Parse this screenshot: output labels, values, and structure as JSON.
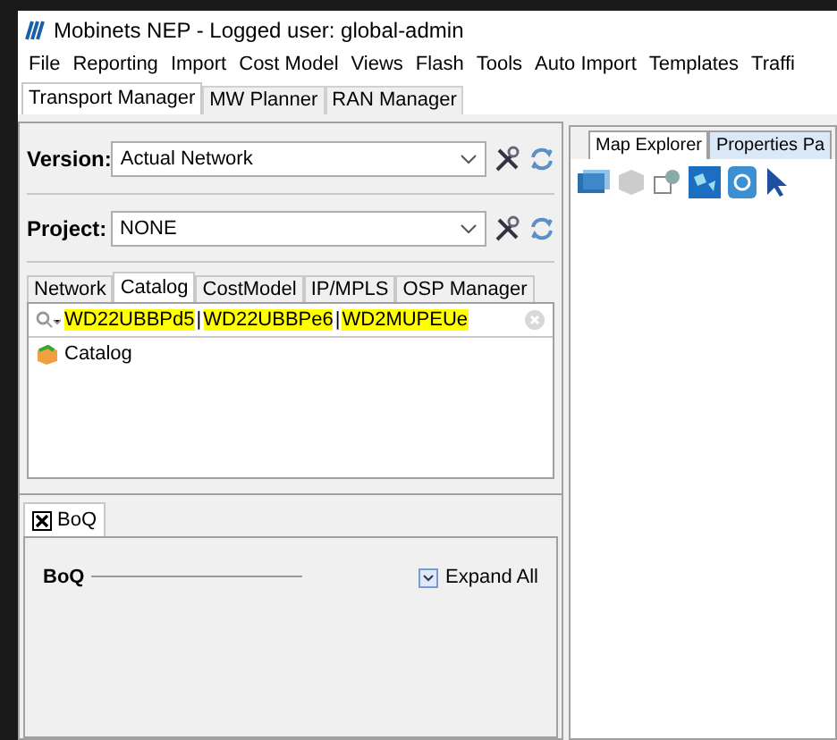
{
  "window": {
    "title": "Mobinets NEP - Logged user: global-admin"
  },
  "menu": [
    "File",
    "Reporting",
    "Import",
    "Cost Model",
    "Views",
    "Flash",
    "Tools",
    "Auto Import",
    "Templates",
    "Traffi"
  ],
  "main_tabs": [
    {
      "label": "Transport Manager",
      "selected": true
    },
    {
      "label": "MW Planner",
      "selected": false
    },
    {
      "label": "RAN Manager",
      "selected": false
    }
  ],
  "version": {
    "label": "Version:",
    "value": "Actual Network"
  },
  "project": {
    "label": "Project:",
    "value": "NONE"
  },
  "sub_tabs": [
    {
      "label": "Network",
      "selected": false
    },
    {
      "label": "Catalog",
      "selected": true
    },
    {
      "label": "CostModel",
      "selected": false
    },
    {
      "label": "IP/MPLS",
      "selected": false
    },
    {
      "label": "OSP Manager",
      "selected": false
    }
  ],
  "search": {
    "segments": [
      {
        "text": "WD22UBBPd5",
        "highlighted": true
      },
      {
        "text": "|",
        "highlighted": false
      },
      {
        "text": "WD22UBBPe6",
        "highlighted": true
      },
      {
        "text": "|",
        "highlighted": false
      },
      {
        "text": "WD2MUPEUe",
        "highlighted": true
      }
    ]
  },
  "tree": [
    {
      "label": "Catalog"
    }
  ],
  "bottom_tab": {
    "label": "BoQ"
  },
  "boq": {
    "title": "BoQ",
    "expand_all": "Expand All",
    "checked": true
  },
  "right_tabs": [
    {
      "label": "Map Explorer",
      "selected": true
    },
    {
      "label": "Properties Pa",
      "selected": false
    }
  ]
}
